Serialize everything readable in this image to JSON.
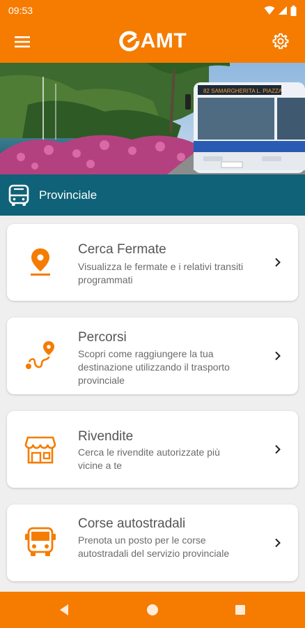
{
  "status_bar": {
    "time": "09:53"
  },
  "app_bar": {
    "logo_text": "AMT"
  },
  "section": {
    "title": "Provinciale"
  },
  "cards": [
    {
      "title": "Cerca Fermate",
      "description": "Visualizza le fermate e i relativi transiti programmati"
    },
    {
      "title": "Percorsi",
      "description": "Scopri come raggiungere la tua destinazione utilizzando il trasporto provinciale"
    },
    {
      "title": "Rivendite",
      "description": "Cerca le rivendite autorizzate più vicine a te"
    },
    {
      "title": "Corse autostradali",
      "description": "Prenota un posto per le corse autostradali del servizio provinciale"
    }
  ],
  "hero": {
    "bus_destination_sign": "82 SAMARGHERITA L. PIAZZA"
  },
  "colors": {
    "brand": "#f57c00",
    "section": "#0f6277"
  },
  "icons": [
    "menu-icon",
    "settings-gear-icon",
    "bus-icon",
    "map-pin-icon",
    "route-icon",
    "store-icon",
    "coach-bus-icon",
    "chevron-right-icon",
    "back-icon",
    "home-icon",
    "recents-icon"
  ]
}
